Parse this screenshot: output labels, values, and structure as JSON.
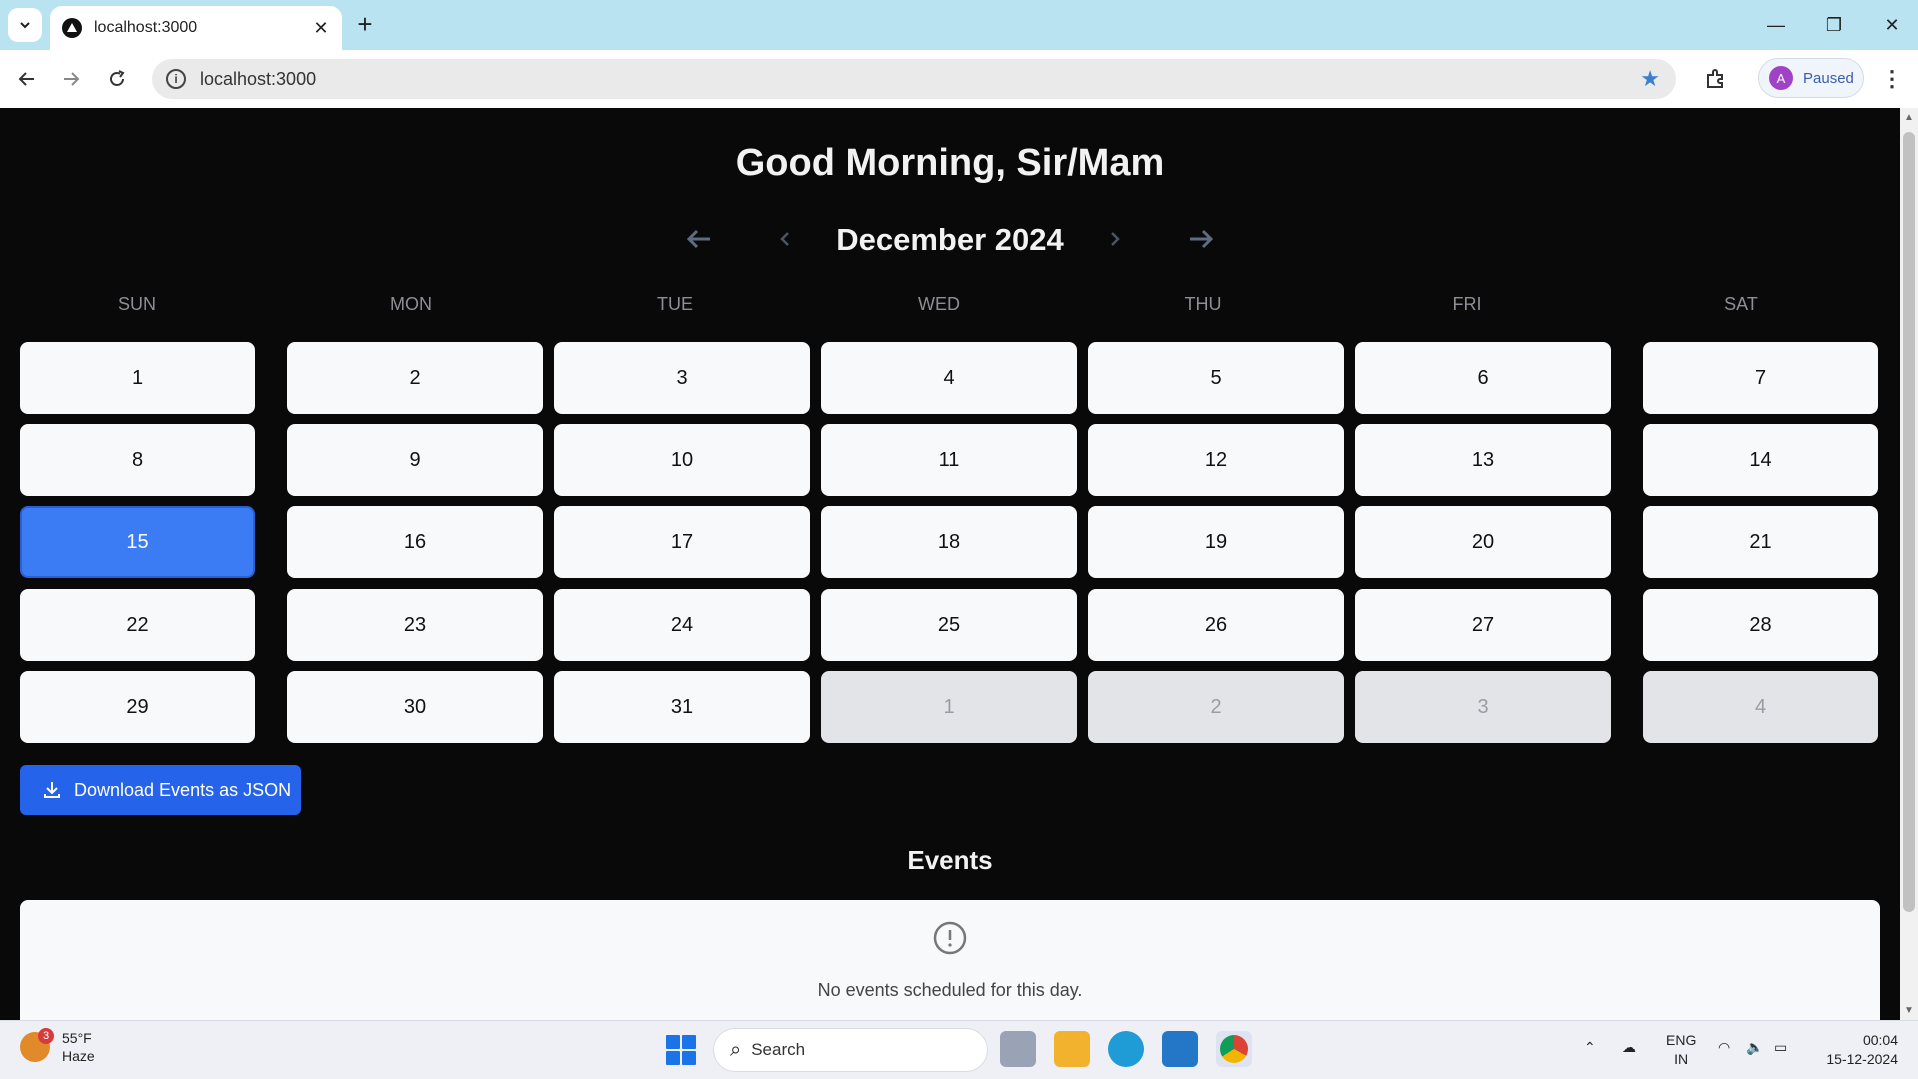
{
  "browser": {
    "tab_title": "localhost:3000",
    "url": "localhost:3000",
    "profile_initial": "A",
    "profile_status": "Paused"
  },
  "page": {
    "greeting": "Good Morning, Sir/Mam",
    "month_title": "December 2024",
    "weekdays": [
      "SUN",
      "MON",
      "TUE",
      "WED",
      "THU",
      "FRI",
      "SAT"
    ],
    "weeks": [
      [
        "1",
        "2",
        "3",
        "4",
        "5",
        "6",
        "7"
      ],
      [
        "8",
        "9",
        "10",
        "11",
        "12",
        "13",
        "14"
      ],
      [
        "15",
        "16",
        "17",
        "18",
        "19",
        "20",
        "21"
      ],
      [
        "22",
        "23",
        "24",
        "25",
        "26",
        "27",
        "28"
      ],
      [
        "29",
        "30",
        "31",
        "1",
        "2",
        "3",
        "4"
      ]
    ],
    "selected_day": "15",
    "download_label": "Download Events as JSON",
    "events_title": "Events",
    "events_empty": "No events scheduled for this day."
  },
  "taskbar": {
    "weather_temp": "55°F",
    "weather_cond": "Haze",
    "weather_badge": "3",
    "search_label": "Search",
    "lang_top": "ENG",
    "lang_bottom": "IN",
    "time": "00:04",
    "date": "15-12-2024"
  },
  "colors": {
    "accent": "#2563eb",
    "selected_day": "#3b7cf5",
    "page_bg": "#090909"
  }
}
